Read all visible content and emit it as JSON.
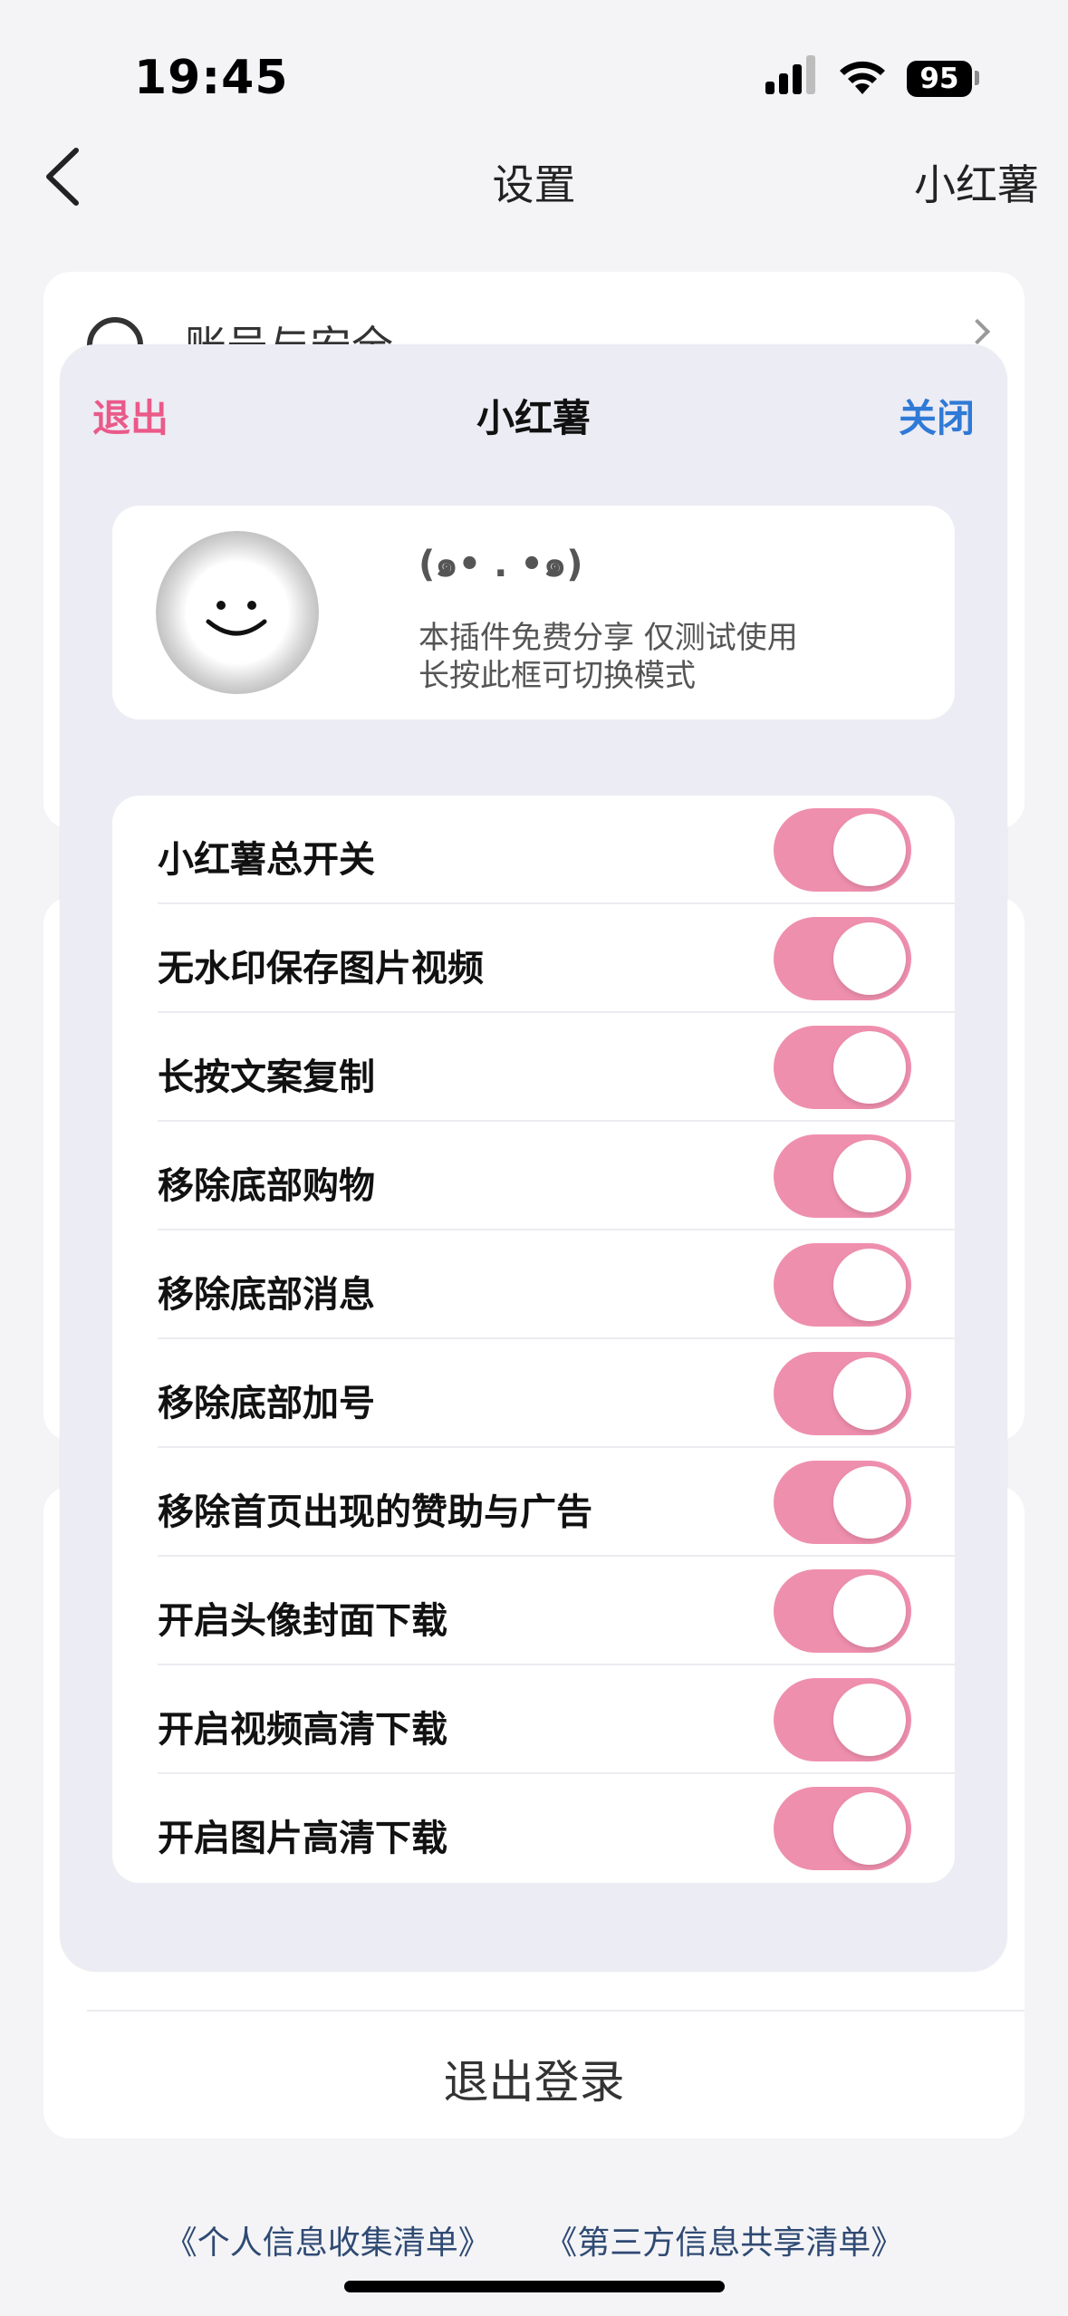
{
  "status_bar": {
    "time": "19:45",
    "battery": "95"
  },
  "nav": {
    "title": "设置",
    "right": "小红薯"
  },
  "background": {
    "partial_row_label": "账号与安全",
    "logout": "退出登录",
    "footer_links": [
      "《个人信息收集清单》",
      "《第三方信息共享清单》"
    ]
  },
  "sheet": {
    "exit_label": "退出",
    "title": "小红薯",
    "close_label": "关闭",
    "info": {
      "kaomoji": "(๑• . •๑)",
      "line1": "本插件免费分享 仅测试使用",
      "line2": "长按此框可切换模式"
    },
    "toggles": [
      {
        "label": "小红薯总开关",
        "on": true
      },
      {
        "label": "无水印保存图片视频",
        "on": true
      },
      {
        "label": "长按文案复制",
        "on": true
      },
      {
        "label": "移除底部购物",
        "on": true
      },
      {
        "label": "移除底部消息",
        "on": true
      },
      {
        "label": "移除底部加号",
        "on": true
      },
      {
        "label": "移除首页出现的赞助与广告",
        "on": true
      },
      {
        "label": "开启头像封面下载",
        "on": true
      },
      {
        "label": "开启视频高清下载",
        "on": true
      },
      {
        "label": "开启图片高清下载",
        "on": true
      }
    ]
  },
  "colors": {
    "accent_pink": "#ef8fae",
    "exit_pink": "#ea5a89",
    "close_blue": "#2f7ad6",
    "footer_link": "#2f4a73"
  }
}
